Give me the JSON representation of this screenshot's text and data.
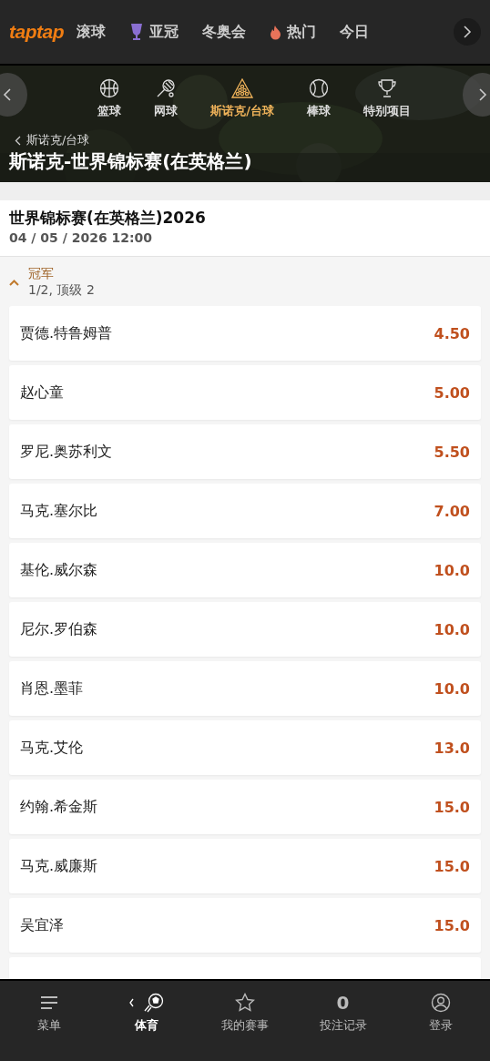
{
  "logo": "taptap",
  "top_nav": [
    {
      "label": "滚球",
      "kind": "plain",
      "selected": false
    },
    {
      "label": "亚冠",
      "kind": "trophy",
      "selected": false
    },
    {
      "label": "冬奥会",
      "kind": "plain",
      "selected": false
    },
    {
      "label": "热门",
      "kind": "flame",
      "selected": false
    },
    {
      "label": "今日",
      "kind": "plain",
      "selected": false
    }
  ],
  "sport_nav": [
    {
      "label": "篮球",
      "kind": "basketball",
      "selected": false
    },
    {
      "label": "网球",
      "kind": "tennis",
      "selected": false
    },
    {
      "label": "斯诺克/台球",
      "kind": "snooker",
      "selected": true
    },
    {
      "label": "棒球",
      "kind": "baseball",
      "selected": false
    },
    {
      "label": "特别项目",
      "kind": "cup",
      "selected": false
    }
  ],
  "breadcrumb": "斯诺克/台球",
  "page_title": "斯诺克-世界锦标赛(在英格兰)",
  "event": {
    "title": "世界锦标赛(在英格兰)2026",
    "date": "04 / 05 / 2026 12:00"
  },
  "market": {
    "name": "冠军",
    "terms": "1/2, 顶级 2",
    "expanded": true
  },
  "selections": [
    {
      "name": "贾德.特鲁姆普",
      "odds": "4.50"
    },
    {
      "name": "赵心童",
      "odds": "5.00"
    },
    {
      "name": "罗尼.奥苏利文",
      "odds": "5.50"
    },
    {
      "name": "马克.塞尔比",
      "odds": "7.00"
    },
    {
      "name": "基伦.威尔森",
      "odds": "10.0"
    },
    {
      "name": "尼尔.罗伯森",
      "odds": "10.0"
    },
    {
      "name": "肖恩.墨菲",
      "odds": "10.0"
    },
    {
      "name": "马克.艾伦",
      "odds": "13.0"
    },
    {
      "name": "约翰.希金斯",
      "odds": "15.0"
    },
    {
      "name": "马克.威廉斯",
      "odds": "15.0"
    },
    {
      "name": "吴宜泽",
      "odds": "15.0"
    }
  ],
  "bottom_nav": [
    {
      "label": "菜单",
      "kind": "menu",
      "selected": false
    },
    {
      "label": "体育",
      "kind": "ball",
      "selected": true
    },
    {
      "label": "我的赛事",
      "kind": "star",
      "selected": false
    },
    {
      "label": "投注记录",
      "kind": "count",
      "count": "0",
      "selected": false
    },
    {
      "label": "登录",
      "kind": "user",
      "selected": false
    }
  ]
}
